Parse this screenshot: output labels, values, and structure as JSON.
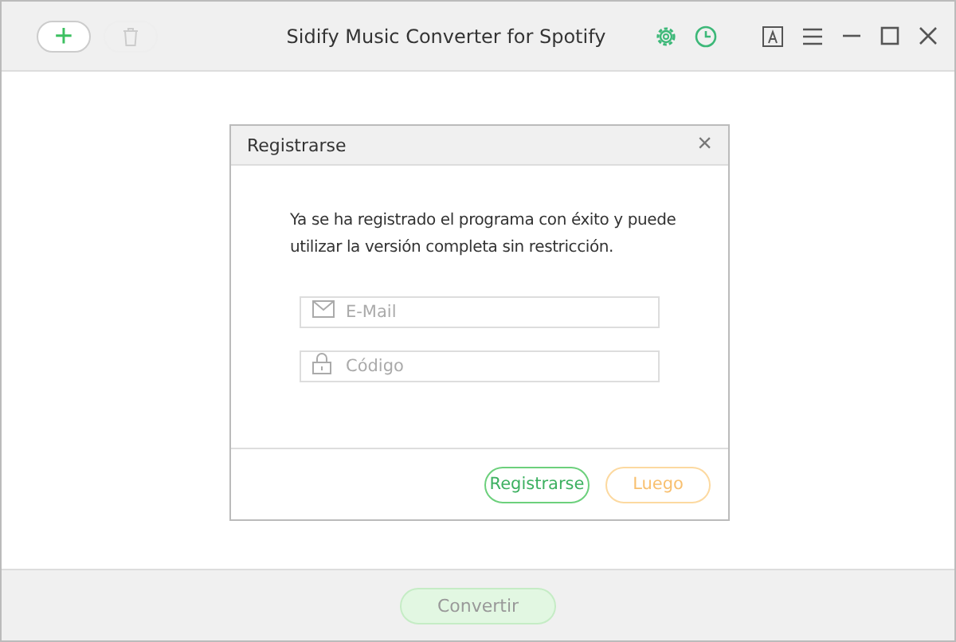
{
  "window": {
    "title": "Sidify Music Converter for Spotify"
  },
  "toolbar": {
    "add": {
      "label": "+",
      "disabled": false
    },
    "delete": {
      "disabled": true
    }
  },
  "dialog": {
    "title": "Registrarse",
    "close": "×",
    "message": "Ya se ha registrado el programa con éxito y puede utilizar la versión completa sin restricción.",
    "fields": [
      {
        "kind": "email",
        "placeholder": "E-Mail"
      },
      {
        "kind": "code",
        "placeholder": "Código"
      }
    ],
    "buttons": [
      {
        "label": "Registrarse",
        "kind": "primary"
      },
      {
        "label": "Luego",
        "kind": "secondary"
      }
    ]
  },
  "convert_button": {
    "label": "Convertir",
    "disabled": true
  }
}
